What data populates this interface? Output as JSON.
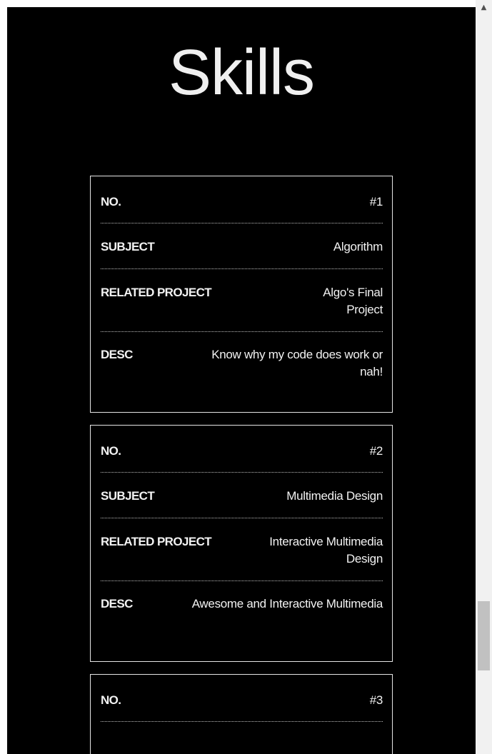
{
  "page": {
    "title": "Skills",
    "background": "#000000",
    "text_color": "#f2f2f2"
  },
  "skills": [
    {
      "no_label": "NO.",
      "no_value": "#1",
      "subject_label": "SUBJECT",
      "subject_value": "Algorithm",
      "related_label": "RELATED PROJECT",
      "related_value": "Algo's Final Project",
      "desc_label": "DESC",
      "desc_value": "Know why my code does work or nah!"
    },
    {
      "no_label": "NO.",
      "no_value": "#2",
      "subject_label": "SUBJECT",
      "subject_value": "Multimedia Design",
      "related_label": "RELATED PROJECT",
      "related_value": "Interactive Multimedia Design",
      "desc_label": "DESC",
      "desc_value": "Awesome and Interactive Multimedia"
    },
    {
      "no_label": "NO.",
      "no_value": "#3"
    }
  ],
  "scrollbar": {
    "up_arrow_icon": "triangle-up",
    "scroll_position": 0.83
  }
}
